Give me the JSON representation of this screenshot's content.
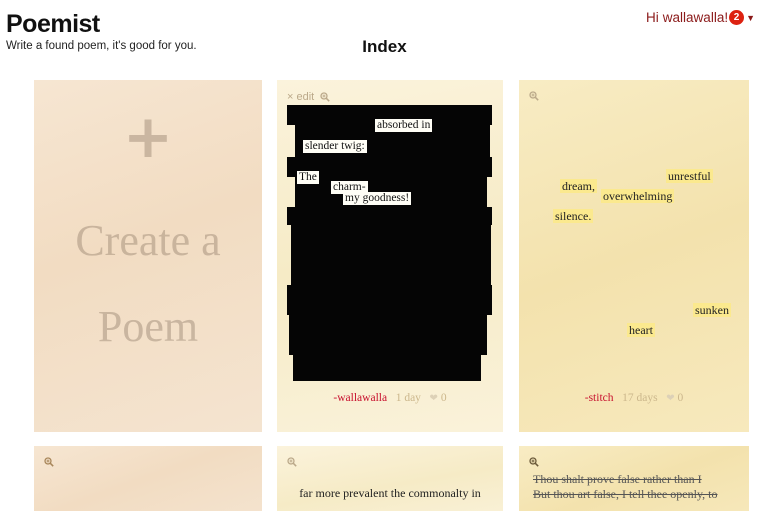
{
  "header": {
    "app_title": "Poemist",
    "tagline": "Write a found poem, it's good for you.",
    "page_title": "Index",
    "greeting": "Hi",
    "username": "wallawalla!",
    "notification_count": "2"
  },
  "create_card": {
    "plus": "+",
    "line1": "Create a",
    "line2": "Poem"
  },
  "poem1": {
    "edit_label": "× edit",
    "words": [
      "absorbed in",
      "slender twig:",
      "The",
      "charm-",
      "my goodness!"
    ],
    "author": "-wallawalla",
    "age": "1 day",
    "likes": "0"
  },
  "poem2": {
    "words": [
      "unrestful",
      "dream,",
      "overwhelming",
      "silence.",
      "sunken",
      "heart"
    ],
    "author": "-stitch",
    "age": "17 days",
    "likes": "0"
  },
  "poem5": {
    "line": "far more prevalent the commonalty in"
  },
  "poem6": {
    "line1": "Thou shalt prove false rather than I",
    "line2": "But thou art false, I tell thee openly, to"
  },
  "colors": {
    "author_red": "#c8102e",
    "highlight_yellow": "#fbe98e",
    "blackout": "#050505",
    "badge_red": "#dd2211"
  },
  "icons": [
    "zoom-in-icon",
    "close-icon",
    "heart-icon",
    "caret-down-icon",
    "plus-icon"
  ]
}
